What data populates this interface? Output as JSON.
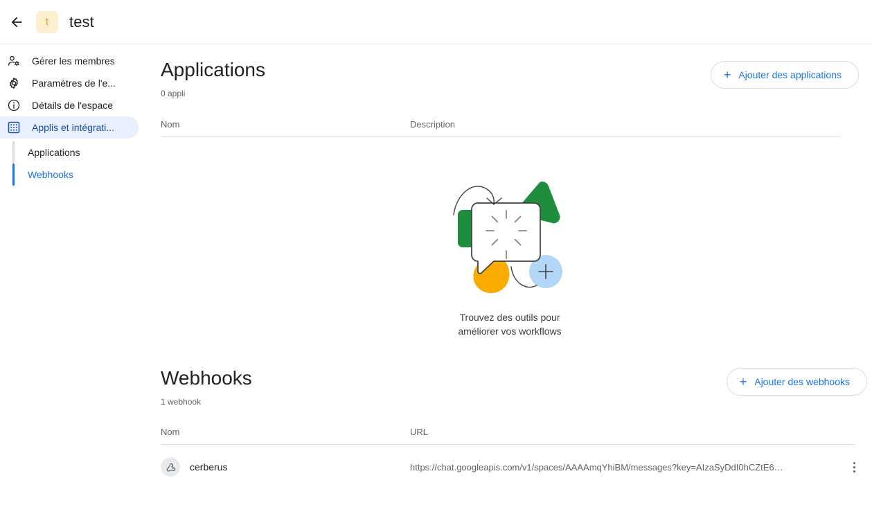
{
  "topbar": {
    "back_icon": "arrow-left-icon",
    "avatar_letter": "t",
    "space_name": "test"
  },
  "sidebar": {
    "items": [
      {
        "icon": "manage-accounts-icon",
        "label": "Gérer les membres",
        "active": false
      },
      {
        "icon": "settings-gear-icon",
        "label": "Paramètres de l'e...",
        "active": false
      },
      {
        "icon": "info-circle-icon",
        "label": "Détails de l'espace",
        "active": false
      },
      {
        "icon": "apps-grid-icon",
        "label": "Applis et intégrati...",
        "active": true
      }
    ],
    "subitems": [
      {
        "label": "Applications",
        "active": false
      },
      {
        "label": "Webhooks",
        "active": true
      }
    ]
  },
  "applications": {
    "title": "Applications",
    "count_label": "0 appli",
    "add_button": {
      "label": "Ajouter des applications",
      "icon": "plus-icon"
    },
    "columns": {
      "name": "Nom",
      "description": "Description"
    },
    "empty_state": {
      "illustration": "workflow-tools-illustration",
      "caption_line1": "Trouvez des outils pour",
      "caption_line2": "améliorer vos workflows"
    },
    "rows": []
  },
  "webhooks": {
    "title": "Webhooks",
    "count_label": "1 webhook",
    "add_button": {
      "label": "Ajouter des webhooks",
      "icon": "plus-icon"
    },
    "columns": {
      "name": "Nom",
      "url": "URL"
    },
    "rows": [
      {
        "icon": "webhook-icon",
        "name": "cerberus",
        "url": "https://chat.googleapis.com/v1/spaces/AAAAmqYhiBM/messages?key=AIzaSyDdI0hCZtE6…",
        "menu_icon": "kebab-menu-icon"
      }
    ]
  },
  "colors": {
    "accent_blue": "#1a73e8",
    "active_nav_bg": "#e8f0fe",
    "active_nav_text": "#174ea6",
    "avatar_bg": "#fdf0d0",
    "avatar_text": "#f29900",
    "text_primary": "#202124",
    "text_secondary": "#5f6368",
    "divider": "#e0e0e0",
    "illu_green": "#1e8e3e",
    "illu_green_light": "#b7e1c4",
    "illu_yellow": "#f9ab00",
    "illu_blue_light": "#b3d7f7"
  }
}
